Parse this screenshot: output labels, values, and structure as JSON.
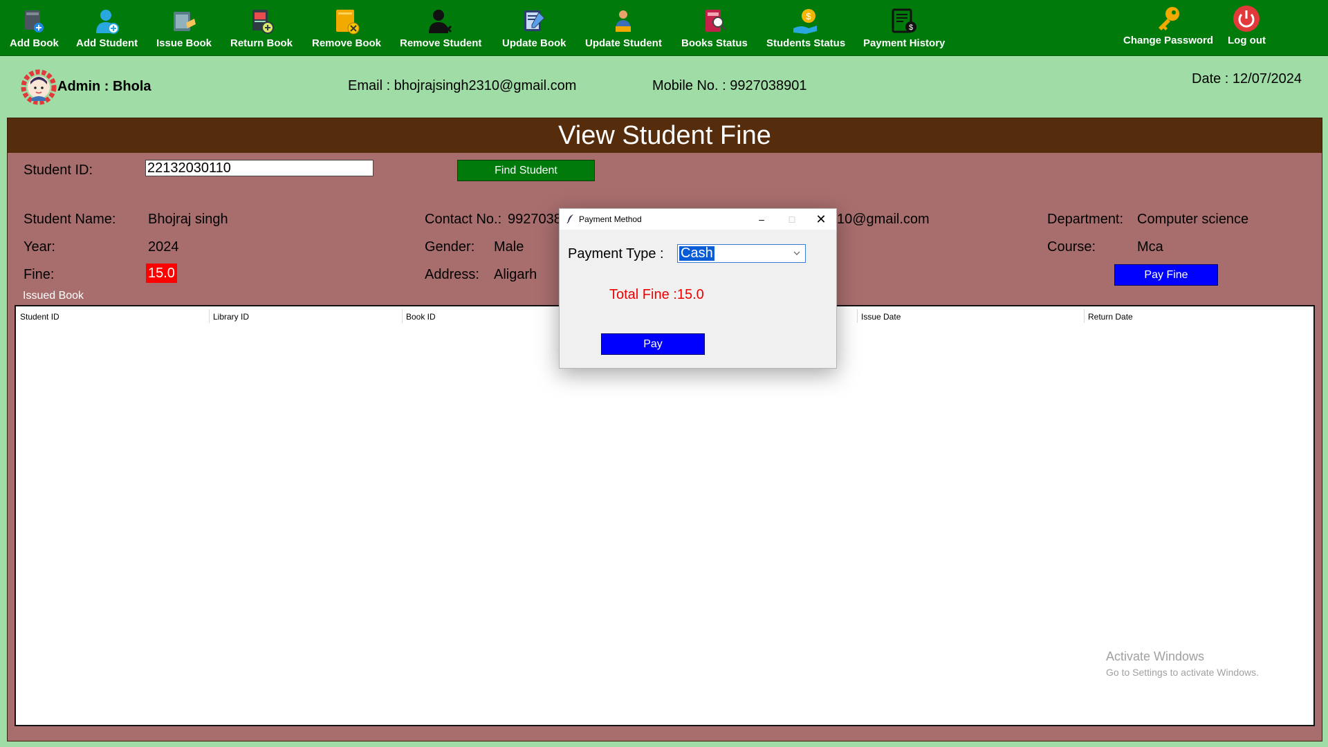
{
  "toolbar": {
    "items": [
      {
        "label": "Add Book",
        "icon": "add-book-icon"
      },
      {
        "label": "Add Student",
        "icon": "add-student-icon"
      },
      {
        "label": "Issue Book",
        "icon": "issue-book-icon"
      },
      {
        "label": "Return Book",
        "icon": "return-book-icon"
      },
      {
        "label": "Remove Book",
        "icon": "remove-book-icon"
      },
      {
        "label": "Remove Student",
        "icon": "remove-student-icon"
      },
      {
        "label": "Update Book",
        "icon": "update-book-icon"
      },
      {
        "label": "Update Student",
        "icon": "update-student-icon"
      },
      {
        "label": "Books Status",
        "icon": "books-status-icon"
      },
      {
        "label": "Students Status",
        "icon": "students-status-icon"
      },
      {
        "label": "Payment History",
        "icon": "payment-history-icon"
      },
      {
        "label": "Change Password",
        "icon": "key-icon"
      },
      {
        "label": "Log out",
        "icon": "power-icon"
      }
    ]
  },
  "admin": {
    "name": "Admin : Bhola",
    "email": "Email : bhojrajsingh2310@gmail.com",
    "mobile": "Mobile No. : 9927038901",
    "date": "Date : 12/07/2024"
  },
  "panel": {
    "title": "View Student Fine",
    "student_id_label": "Student ID:",
    "student_id_value": "22132030110",
    "find_button": "Find Student",
    "fields": {
      "name_label": "Student Name:",
      "name_value": "Bhojraj singh",
      "year_label": "Year:",
      "year_value": "2024",
      "fine_label": "Fine:",
      "fine_value": "15.0",
      "contact_label": "Contact No.:",
      "contact_value": "9927038",
      "gender_label": "Gender:",
      "gender_value": "Male",
      "address_label": "Address:",
      "address_value": "Aligarh",
      "email_partial": "10@gmail.com",
      "department_label": "Department:",
      "department_value": "Computer science",
      "course_label": "Course:",
      "course_value": "Mca"
    },
    "pay_fine_button": "Pay Fine",
    "issued_label": "Issued Book",
    "table_headers": [
      "Student ID",
      "Library ID",
      "Book ID",
      "Issue Date",
      "Return Date"
    ]
  },
  "watermark": {
    "line1": "Activate Windows",
    "line2": "Go to Settings to activate Windows."
  },
  "dialog": {
    "title": "Payment Method",
    "payment_type_label": "Payment Type :",
    "payment_type_value": "Cash",
    "total_fine": "Total Fine :15.0",
    "pay_button": "Pay"
  },
  "colors": {
    "toolbar": "#007a0b",
    "background": "#a0dca6",
    "panel": "#a86e6e",
    "panel_header": "#562d0c",
    "fine_badge": "#ff0000",
    "blue_button": "#0000ff"
  }
}
